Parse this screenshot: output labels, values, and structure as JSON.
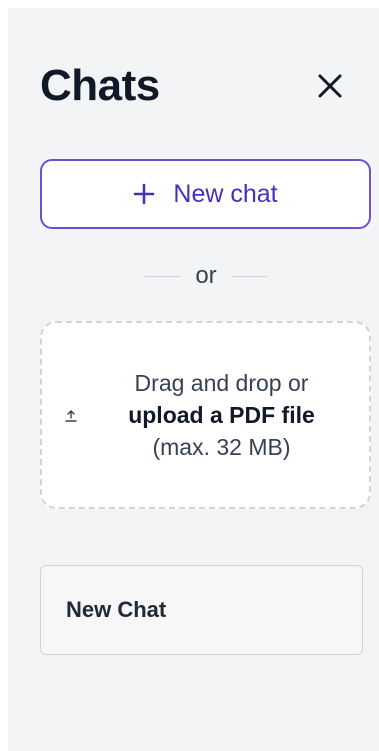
{
  "sidebar": {
    "title": "Chats",
    "close_icon": "close-icon",
    "new_chat_label": "New chat",
    "new_chat_icon": "plus-icon",
    "divider_text": "or",
    "upload": {
      "line1": "Drag and drop or",
      "line2": "upload a PDF file",
      "line3": "(max. 32 MB)",
      "icon": "upload-icon"
    },
    "chats": [
      {
        "label": "New Chat"
      }
    ]
  },
  "colors": {
    "accent": "#6d4fd4",
    "accent_text": "#4c2ebd",
    "sidebar_bg": "#f3f4f6"
  }
}
